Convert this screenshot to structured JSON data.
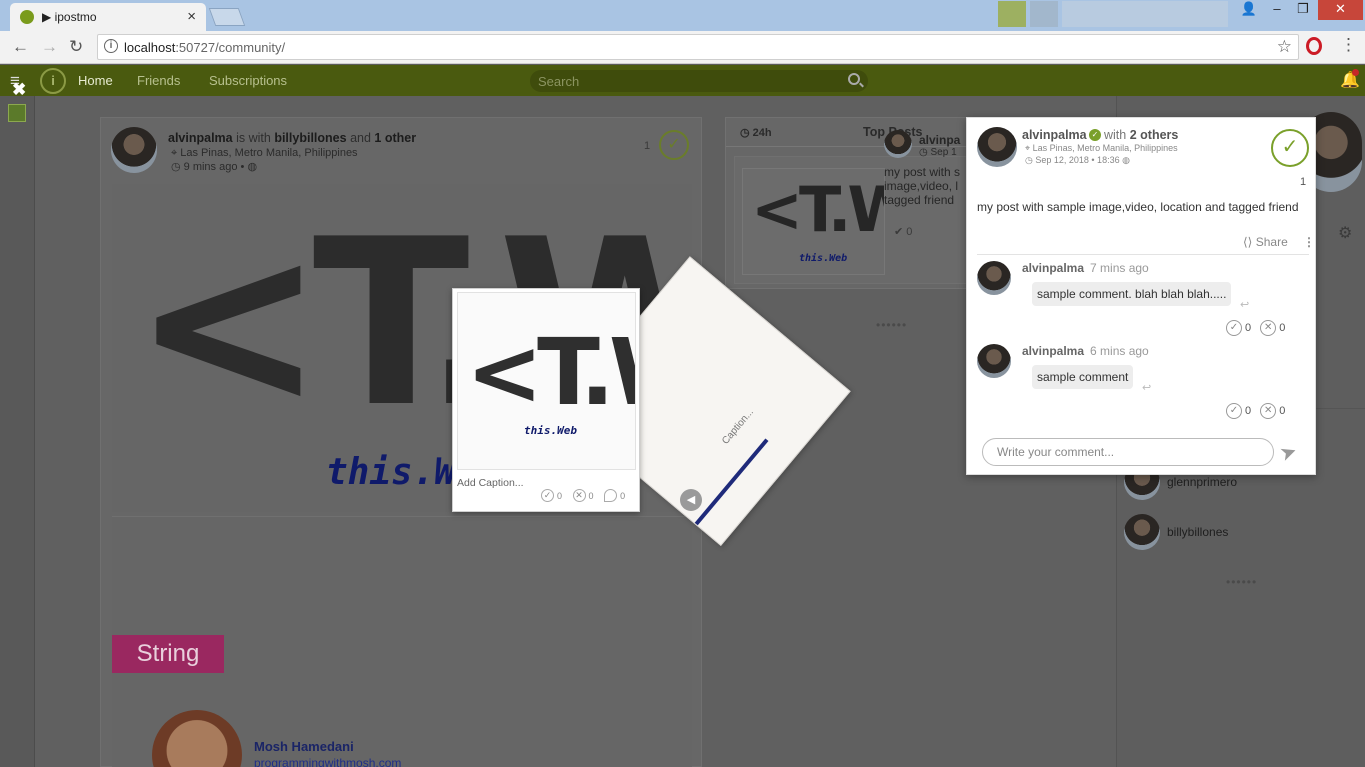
{
  "browser": {
    "tab_title": "ipostmo",
    "tab_play": "▶",
    "tab_close": "×",
    "url_host": "localhost",
    "url_path": ":50727/community/",
    "window": {
      "minimize": "–",
      "maximize": "❐",
      "close": "✕",
      "profile": "👤"
    },
    "nav": {
      "back": "←",
      "forward": "→",
      "reload": "↻",
      "star": "☆",
      "menu": "⋮"
    }
  },
  "app": {
    "logo": "i",
    "menu_icon": "≡",
    "nav": {
      "home": "Home",
      "friends": "Friends",
      "subscriptions": "Subscriptions"
    },
    "search_placeholder": "Search",
    "bell": "🔔",
    "close_overlay": "✖"
  },
  "post": {
    "author": "alvinpalma",
    "is_with": "is with",
    "tagged": "billybillones",
    "and": "and",
    "others": "1 other",
    "location": "Las Pinas, Metro Manila, Philippines",
    "time": "9 mins ago",
    "globe": "•",
    "count": "1",
    "check": "✓",
    "image_mark": "<T.W>",
    "image_sub": "this.Web",
    "video_badge": "String",
    "video_author": "Mosh Hamedani",
    "video_url": "programmingwithmosh.com"
  },
  "top_posts": {
    "period": "24h",
    "title": "Top Posts",
    "item": {
      "author": "alvinpa",
      "date": "Sep 1",
      "text": "my post with s image,video, l tagged friend",
      "likes": "0"
    },
    "dots": "••••••"
  },
  "polaroid": {
    "mark": "<T.W>",
    "sub": "this.Web",
    "caption": "Add Caption...",
    "likes": "0",
    "dislikes": "0",
    "comments": "0"
  },
  "tilted": {
    "caption": "Caption..."
  },
  "right_col": {
    "friends": [
      {
        "name": "glennprimero"
      },
      {
        "name": "billybillones"
      }
    ],
    "dots": "••••••",
    "gear": "⚙"
  },
  "popup": {
    "author": "alvinpalma",
    "verify": "✓",
    "with": "with",
    "others": "2 others",
    "location": "Las Pinas, Metro Manila, Philippines",
    "datetime": "Sep 12, 2018 • 18:36",
    "check": "✓",
    "count": "1",
    "body": "my post with sample image,video, location and tagged friend",
    "share": "Share",
    "comments": [
      {
        "author": "alvinpalma",
        "time": "7 mins ago",
        "text": "sample comment. blah blah blah.....",
        "likes": "0",
        "dislikes": "0"
      },
      {
        "author": "alvinpalma",
        "time": "6 mins ago",
        "text": "sample comment",
        "likes": "0",
        "dislikes": "0"
      }
    ],
    "comment_placeholder": "Write your comment...",
    "send": "➤"
  },
  "colors": {
    "brand_green": "#4a5a0f",
    "accent_check": "#7aa02a",
    "overlay": "#5a5a5a"
  }
}
